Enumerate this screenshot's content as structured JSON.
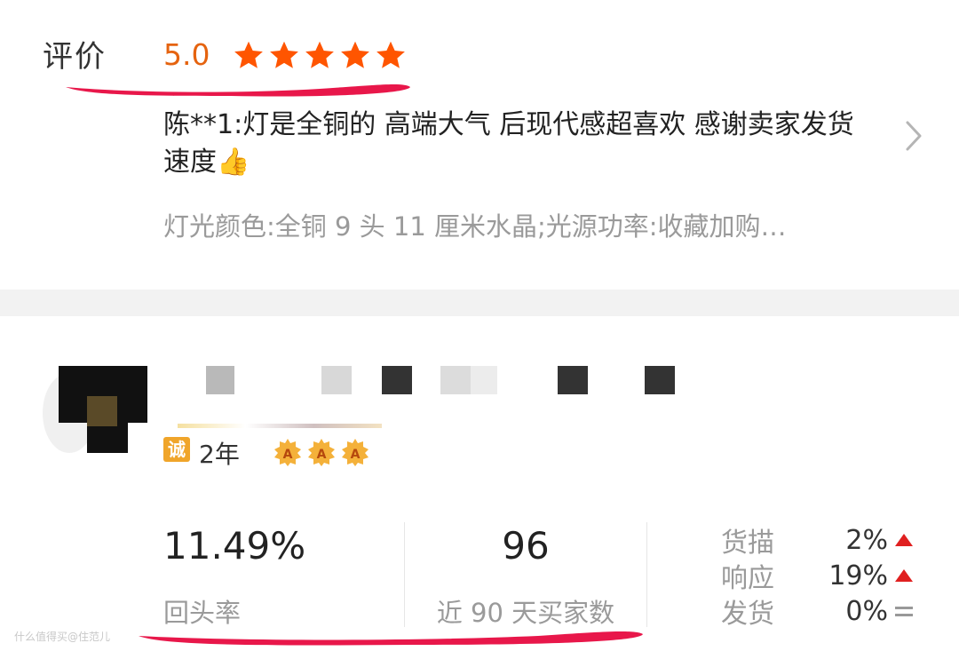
{
  "review": {
    "label": "评价",
    "score": "5.0",
    "stars": 5,
    "comment": "陈**1:灯是全铜的 高端大气 后现代感超喜欢 感谢卖家发货速度",
    "thumb_emoji": "👍",
    "spec": "灯光颜色:全铜 9 头 11 厘米水晶;光源功率:收藏加购…"
  },
  "shop": {
    "cheng_badge": "诚",
    "years": "2年",
    "crown_letter": "A",
    "crowns": 3
  },
  "stats": {
    "repurchase_value": "11.49%",
    "repurchase_label": "回头率",
    "buyers_value": "96",
    "buyers_label": "近 90 天买家数"
  },
  "ratings": [
    {
      "label": "货描",
      "value": "2%",
      "trend": "up"
    },
    {
      "label": "响应",
      "value": "19%",
      "trend": "up"
    },
    {
      "label": "发货",
      "value": "0%",
      "trend": "equal"
    }
  ],
  "watermark": "什么值得买@住范儿",
  "colors": {
    "accent": "#e5630f",
    "star": "#ff5500",
    "up": "#e02020",
    "annotation": "#e8174a"
  }
}
